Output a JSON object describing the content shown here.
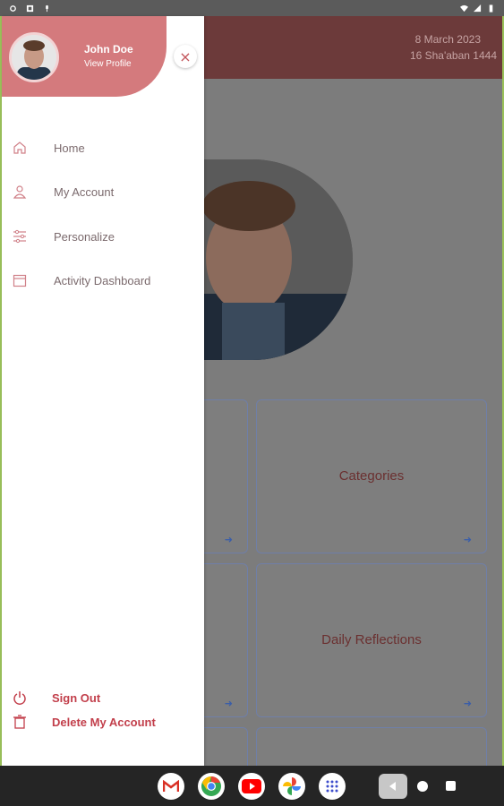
{
  "user": {
    "name": "John Doe",
    "view_profile": "View Profile"
  },
  "dates": {
    "gregorian": "8 March 2023",
    "hijri": "16 Sha'aban 1444"
  },
  "menu": [
    {
      "label": "Home",
      "icon": "home-icon"
    },
    {
      "label": "My Account",
      "icon": "user-icon"
    },
    {
      "label": "Personalize",
      "icon": "sliders-icon"
    },
    {
      "label": "Activity Dashboard",
      "icon": "calendar-icon"
    }
  ],
  "actions": {
    "sign_out": "Sign Out",
    "delete_account": "Delete My Account"
  },
  "cards": {
    "categories": "Categories",
    "daily_reflections": "Daily Reflections"
  },
  "close_glyph": "×",
  "colors": {
    "drawer_header": "#d47a7d",
    "accent": "#c23f4b",
    "app_header": "#6c3a3a"
  },
  "nav_apps": [
    "gmail-icon",
    "chrome-icon",
    "youtube-icon",
    "photos-icon",
    "app-drawer-icon"
  ]
}
